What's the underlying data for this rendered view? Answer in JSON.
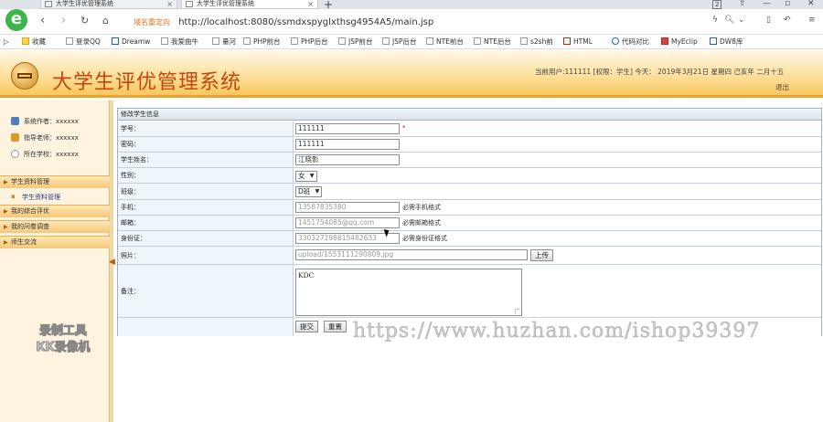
{
  "browser": {
    "tabs": [
      {
        "title": "大学生评优管理系统",
        "active": false
      },
      {
        "title": "大学生评优管理系统",
        "active": true
      }
    ],
    "new_tab": "+",
    "page_counter": "2",
    "address_prefix": "域名重定向",
    "url": "http://localhost:8080/ssmdxspyglxthsg4954A5/main.jsp",
    "bookmarks": [
      "收藏",
      "登录QQ",
      "Dreamw",
      "我爱曲牛",
      "量河",
      "PHP前台",
      "PHP后台",
      "JSP前台",
      "JSP后台",
      "NTE前台",
      "NTE后台",
      "s2sh前",
      "HTML",
      "代码对比",
      "MyEclip",
      "DW8库"
    ]
  },
  "header": {
    "title": "大学生评优管理系统",
    "userinfo": "当前用户:111111 [权限：学生] 今天： 2019年3月21日 星期四 己亥年 二月十五",
    "logout": "退出"
  },
  "sidebar": {
    "info": [
      {
        "label": "系统作者：xxxxxx",
        "icon": "user-icon",
        "color": "#4d7fb8"
      },
      {
        "label": "指导老师：xxxxxx",
        "icon": "teacher-icon",
        "color": "#d79b2a"
      },
      {
        "label": "所在学校：xxxxxx",
        "icon": "school-icon",
        "color": "#9a9a9a"
      }
    ],
    "menus": [
      {
        "label": "学生资料管理",
        "submenu": [
          "学生资料管理"
        ]
      },
      {
        "label": "我的综合评优"
      },
      {
        "label": "我的问卷调查"
      },
      {
        "label": "师生交流"
      }
    ]
  },
  "form": {
    "panel_title": "修改学生信息",
    "fields": {
      "xuehao": {
        "label": "学号：",
        "value": "111111",
        "suffix": "*"
      },
      "mima": {
        "label": "密码：",
        "value": "111111"
      },
      "name": {
        "label": "学生姓名：",
        "value": "江晓影"
      },
      "gender": {
        "label": "性别：",
        "value": "女"
      },
      "class": {
        "label": "班级：",
        "value": "D班"
      },
      "phone": {
        "label": "手机：",
        "value": "13587835380",
        "hint": "必需手机格式"
      },
      "email": {
        "label": "邮箱：",
        "value": "1451754085@qq.com",
        "hint": "必需邮箱格式"
      },
      "idcard": {
        "label": "身份证：",
        "value": "330327198615482633",
        "hint": "必需身份证格式"
      },
      "photo": {
        "label": "照片：",
        "value": "upload/1553111290809.jpg",
        "upload_label": "上传"
      },
      "remark": {
        "label": "备注：",
        "value": "KDC"
      }
    },
    "submit_label": "提交",
    "reset_label": "重置"
  },
  "watermarks": {
    "url": "https://www.huzhan.com/ishop39397",
    "recorder_line1": "录制工具",
    "recorder_line2": "KK录像机"
  }
}
